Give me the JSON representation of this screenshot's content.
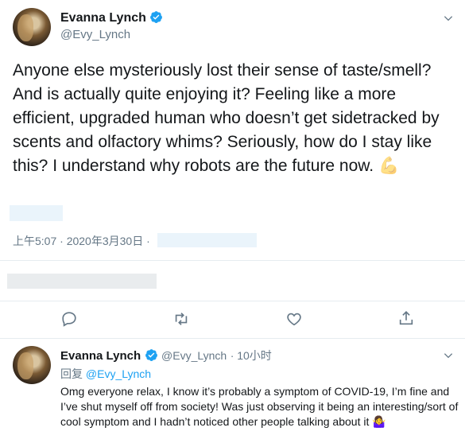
{
  "tweet": {
    "name": "Evanna Lynch",
    "handle": "@Evy_Lynch",
    "text": "Anyone else mysteriously lost their sense of taste/smell? And is actually quite enjoying it? Feeling like a more efficient, upgraded human who doesn’t get sidetracked by scents and olfactory whims? Seriously, how do I stay like this? I understand why robots are the future now.",
    "emoji": "💪",
    "timestamp": "上午5:07 · 2020年3月30日 ·"
  },
  "reply": {
    "name": "Evanna Lynch",
    "handle": "@Evy_Lynch",
    "time": "· 10小时",
    "replying_prefix": "回复",
    "replying_to": "@Evy_Lynch",
    "text": "Omg everyone relax, I know it’s probably a symptom of COVID-19, I’m fine and I’ve shut myself off from society! Was just observing it being an interesting/sort of cool symptom and I hadn’t noticed other people talking about it",
    "emoji": "🤷‍♀️"
  },
  "colors": {
    "accent": "#1da1f2",
    "muted": "#657786",
    "text": "#14171a"
  },
  "icons": [
    "verified-badge-icon",
    "caret-down-icon",
    "reply-icon",
    "retweet-icon",
    "like-icon",
    "share-icon"
  ]
}
